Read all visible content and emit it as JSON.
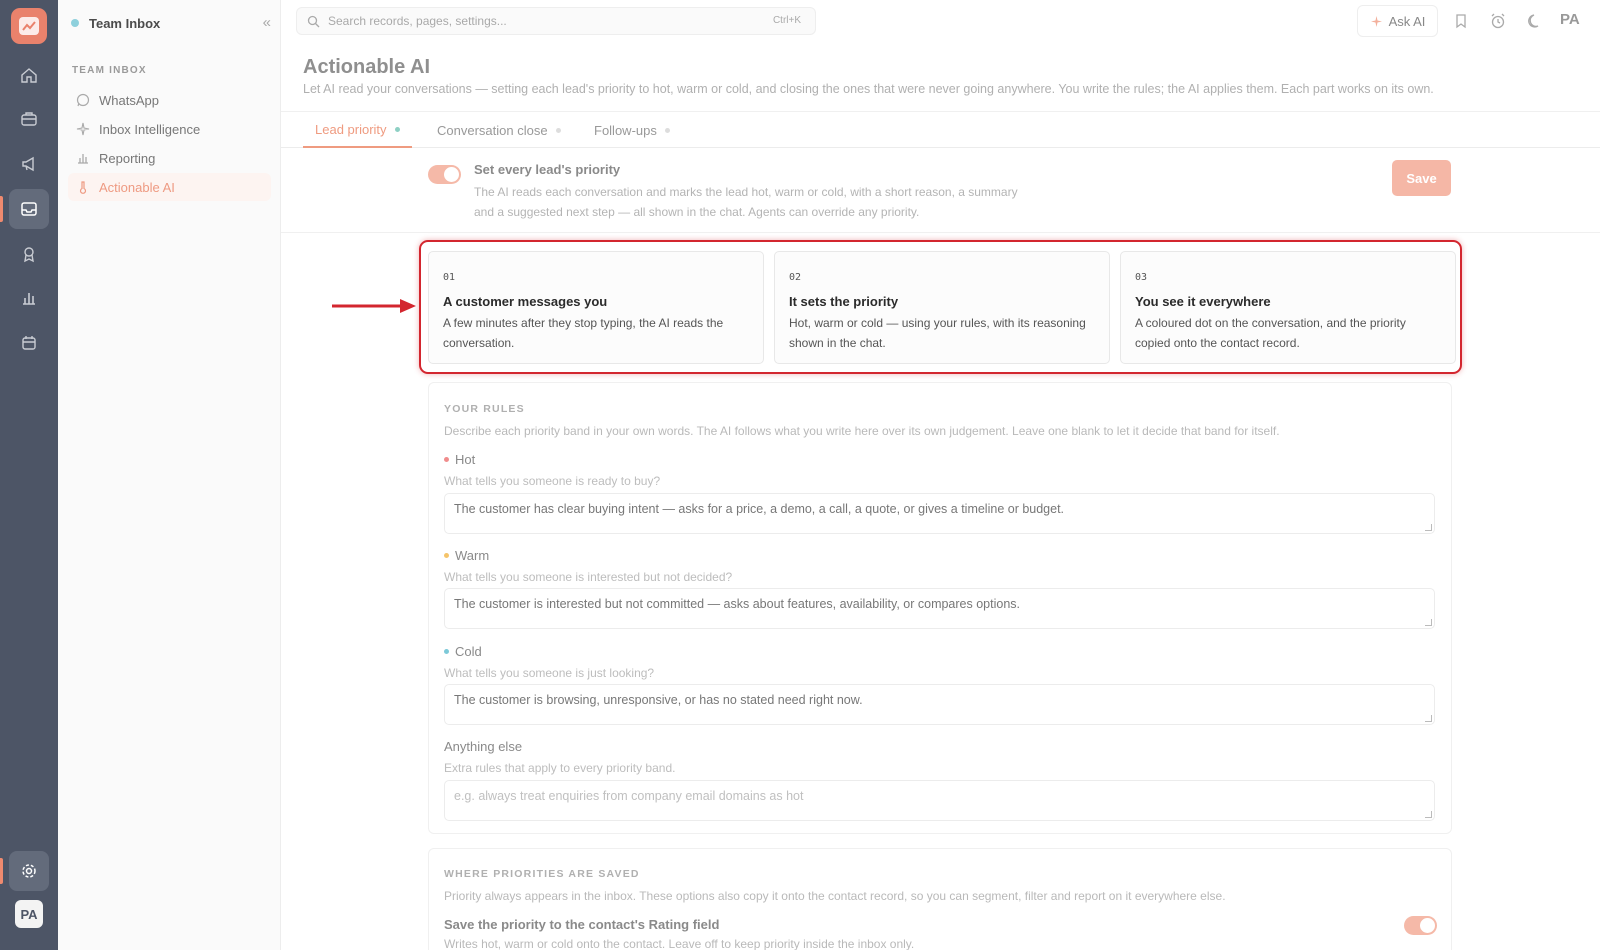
{
  "sidebar": {
    "workspace": "Team Inbox",
    "collapse_glyph": "«",
    "section": "TEAM INBOX",
    "items": [
      {
        "label": "WhatsApp",
        "icon": "whatsapp-icon"
      },
      {
        "label": "Inbox Intelligence",
        "icon": "sparkle-icon"
      },
      {
        "label": "Reporting",
        "icon": "chart-icon"
      },
      {
        "label": "Actionable AI",
        "icon": "thermometer-icon",
        "active": true
      }
    ]
  },
  "rail": {
    "icons": [
      "home-icon",
      "briefcase-icon",
      "megaphone-icon",
      "inbox-icon",
      "badge-icon",
      "chart-icon",
      "calendar-icon",
      "gear-icon"
    ],
    "avatar": "PA"
  },
  "topbar": {
    "search_placeholder": "Search records, pages, settings...",
    "shortcut": "Ctrl+K",
    "ask_ai": "Ask AI",
    "avatar": "PA"
  },
  "page": {
    "title": "Actionable AI",
    "description": "Let AI read your conversations — setting each lead's priority to hot, warm or cold, and closing the ones that were never going anywhere. You write the rules; the AI applies them. Each part works on its own."
  },
  "tabs": [
    {
      "label": "Lead priority",
      "active": true
    },
    {
      "label": "Conversation close"
    },
    {
      "label": "Follow-ups"
    }
  ],
  "setting": {
    "enabled": true,
    "title": "Set every lead's priority",
    "description": "The AI reads each conversation and marks the lead hot, warm or cold, with a short reason, a summary and a suggested next step — all shown in the chat. Agents can override any priority.",
    "save_label": "Save"
  },
  "steps": [
    {
      "num": "01",
      "title": "A customer messages you",
      "desc": "A few minutes after they stop typing, the AI reads the conversation."
    },
    {
      "num": "02",
      "title": "It sets the priority",
      "desc": "Hot, warm or cold — using your rules, with its reasoning shown in the chat."
    },
    {
      "num": "03",
      "title": "You see it everywhere",
      "desc": "A coloured dot on the conversation, and the priority copied onto the contact record."
    }
  ],
  "rules": {
    "label": "YOUR RULES",
    "description": "Describe each priority band in your own words. The AI follows what you write here over its own judgement. Leave one blank to let it decide that band for itself.",
    "bands": [
      {
        "name": "Hot",
        "color": "#f08c8c",
        "hint": "What tells you someone is ready to buy?",
        "value": "The customer has clear buying intent — asks for a price, a demo, a call, a quote, or gives a timeline or budget."
      },
      {
        "name": "Warm",
        "color": "#f5c46a",
        "hint": "What tells you someone is interested but not decided?",
        "value": "The customer is interested but not committed — asks about features, availability, or compares options."
      },
      {
        "name": "Cold",
        "color": "#7cc9d8",
        "hint": "What tells you someone is just looking?",
        "value": "The customer is browsing, unresponsive, or has no stated need right now."
      }
    ],
    "extra": {
      "name": "Anything else",
      "hint": "Extra rules that apply to every priority band.",
      "placeholder": "e.g. always treat enquiries from company email domains as hot"
    }
  },
  "saved": {
    "label": "WHERE PRIORITIES ARE SAVED",
    "description": "Priority always appears in the inbox. These options also copy it onto the contact record, so you can segment, filter and report on it everywhere else.",
    "option_title": "Save the priority to the contact's Rating field",
    "option_desc": "Writes hot, warm or cold onto the contact. Leave off to keep priority inside the inbox only.",
    "option_enabled": true
  },
  "colors": {
    "accent": "#ef9b80",
    "rail": "#4d5566",
    "highlight": "#d3262f"
  }
}
